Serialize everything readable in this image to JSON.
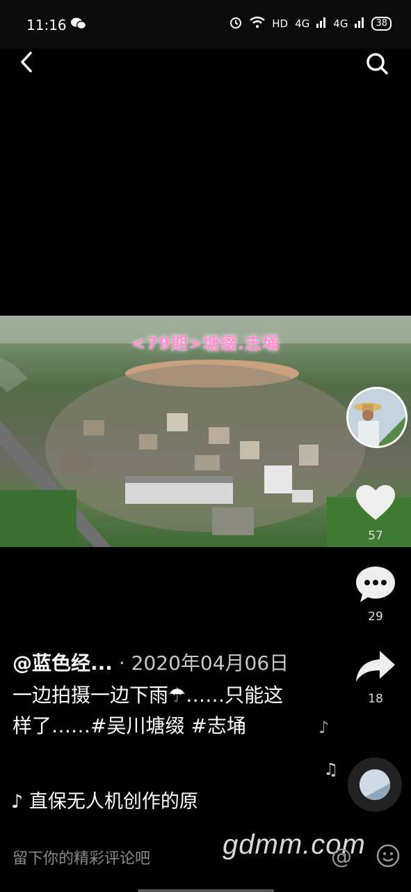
{
  "status_bar": {
    "time": "11:16",
    "network_hd": "HD",
    "signal_1": "4G",
    "signal_2": "4G",
    "battery": "38"
  },
  "video": {
    "overlay_title": "<79期>塘缀.志埇"
  },
  "actions": {
    "likes": "57",
    "comments": "29",
    "shares": "18"
  },
  "post": {
    "author": "@蓝色经...",
    "date": "· 2020年04月06日",
    "caption": "一边拍摄一边下雨☂……只能这样了……#吴川塘缀 #志埇",
    "music": "直保无人机创作的原"
  },
  "comment_bar": {
    "placeholder": "留下你的精彩评论吧"
  },
  "watermark": "gdmm.com",
  "icons": {
    "back": "back-arrow-icon",
    "search": "search-icon",
    "like": "heart-icon",
    "comment": "comment-bubble-icon",
    "share": "share-arrow-icon",
    "music": "music-note-icon",
    "mention": "at-icon",
    "emoji": "emoji-icon"
  }
}
